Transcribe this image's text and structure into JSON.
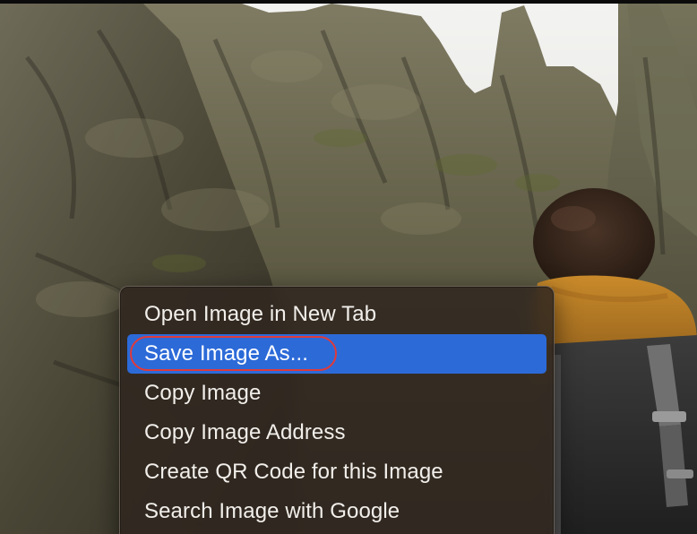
{
  "context_menu": {
    "items": [
      {
        "label": "Open Image in New Tab",
        "selected": false
      },
      {
        "label": "Save Image As...",
        "selected": true,
        "annotated": true
      },
      {
        "label": "Copy Image",
        "selected": false
      },
      {
        "label": "Copy Image Address",
        "selected": false
      },
      {
        "label": "Create QR Code for this Image",
        "selected": false
      },
      {
        "label": "Search Image with Google",
        "selected": false
      }
    ]
  },
  "colors": {
    "selection": "#2c6ad8",
    "annotation": "#e03a3a",
    "menu_text": "#f2efeb"
  },
  "background": {
    "description_icon": "mountain-hiker-photo"
  }
}
